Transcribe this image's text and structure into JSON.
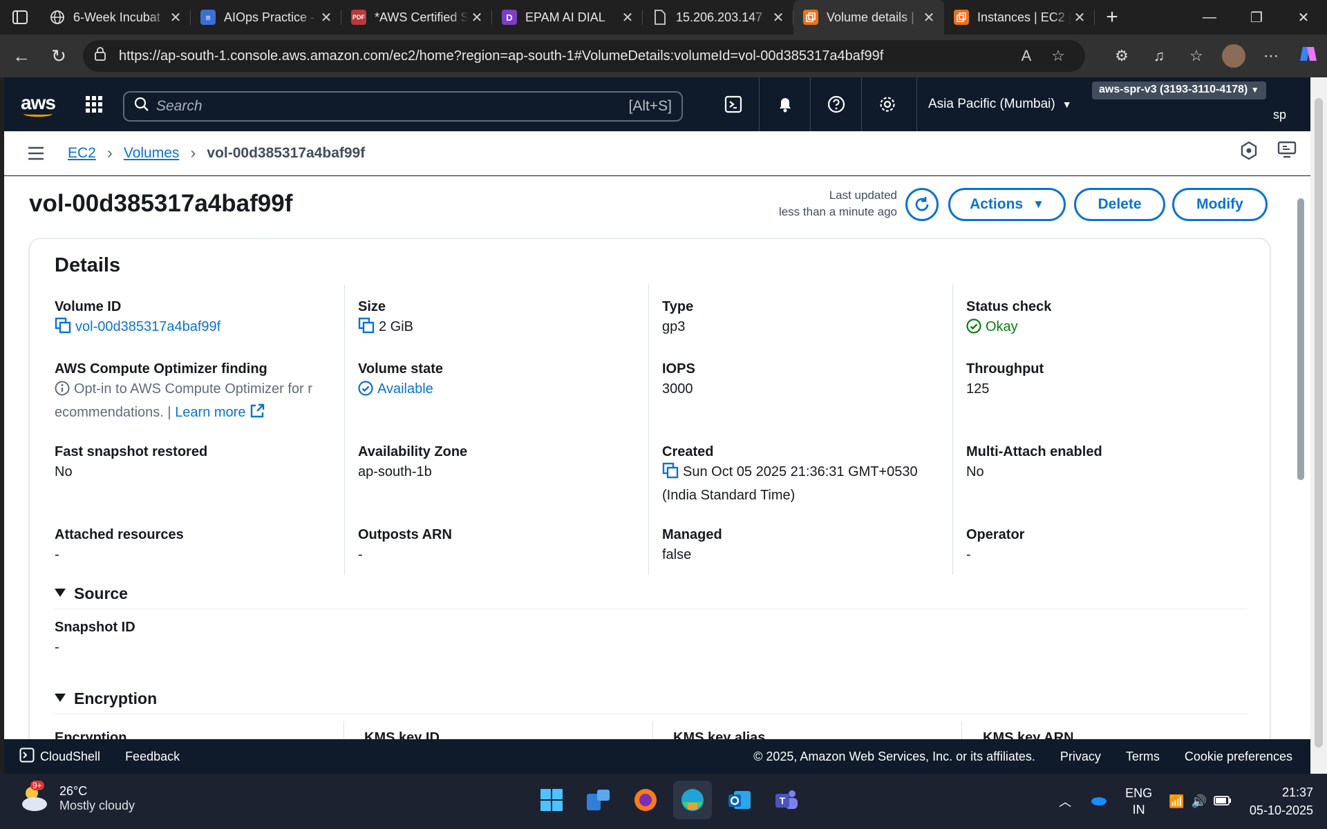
{
  "browser": {
    "tabs": [
      {
        "title": "6-Week Incubat",
        "icon": "globe-icon",
        "color": "#3a3a3a"
      },
      {
        "title": "AIOps Practice -",
        "icon": "docs-icon",
        "color": "#3b6fd6"
      },
      {
        "title": "*AWS Certified S",
        "icon": "pdf-icon",
        "color": "#b83a3a"
      },
      {
        "title": "EPAM AI DIAL",
        "icon": "dial-icon",
        "color": "#7b3fc4"
      },
      {
        "title": "15.206.203.147",
        "icon": "page-icon",
        "color": "#3a3a3a"
      },
      {
        "title": "Volume details |",
        "icon": "aws-ec2-icon",
        "color": "#e8731d",
        "active": true
      },
      {
        "title": "Instances | EC2 |",
        "icon": "aws-ec2-icon",
        "color": "#e8731d"
      }
    ],
    "url": "https://ap-south-1.console.aws.amazon.com/ec2/home?region=ap-south-1#VolumeDetails:volumeId=vol-00d385317a4baf99f"
  },
  "aws": {
    "search_placeholder": "Search",
    "search_shortcut": "[Alt+S]",
    "region": "Asia Pacific (Mumbai)",
    "account": "aws-spr-v3 (3193-3110-4178)",
    "user": "sp"
  },
  "breadcrumb": {
    "items": [
      "EC2",
      "Volumes",
      "vol-00d385317a4baf99f"
    ]
  },
  "page": {
    "title": "vol-00d385317a4baf99f",
    "last_updated_label": "Last updated",
    "last_updated_value": "less than a minute ago",
    "actions_label": "Actions",
    "delete_label": "Delete",
    "modify_label": "Modify"
  },
  "details": {
    "heading": "Details",
    "volume_id": {
      "label": "Volume ID",
      "value": "vol-00d385317a4baf99f"
    },
    "size": {
      "label": "Size",
      "value": "2 GiB"
    },
    "type": {
      "label": "Type",
      "value": "gp3"
    },
    "status_check": {
      "label": "Status check",
      "value": "Okay"
    },
    "optimizer": {
      "label": "AWS Compute Optimizer finding",
      "value_line1": "Opt-in to AWS Compute Optimizer for r",
      "value_line2": "ecommendations. |",
      "learn_more": "Learn more"
    },
    "volume_state": {
      "label": "Volume state",
      "value": "Available"
    },
    "iops": {
      "label": "IOPS",
      "value": "3000"
    },
    "throughput": {
      "label": "Throughput",
      "value": "125"
    },
    "fast_snapshot": {
      "label": "Fast snapshot restored",
      "value": "No"
    },
    "az": {
      "label": "Availability Zone",
      "value": "ap-south-1b"
    },
    "created": {
      "label": "Created",
      "value_line1": "Sun Oct 05 2025 21:36:31 GMT+0530",
      "value_line2": "(India Standard Time)"
    },
    "multi_attach": {
      "label": "Multi-Attach enabled",
      "value": "No"
    },
    "attached": {
      "label": "Attached resources",
      "value": "-"
    },
    "outposts": {
      "label": "Outposts ARN",
      "value": "-"
    },
    "managed": {
      "label": "Managed",
      "value": "false"
    },
    "operator": {
      "label": "Operator",
      "value": "-"
    }
  },
  "source": {
    "heading": "Source",
    "snapshot_label": "Snapshot ID",
    "snapshot_value": "-"
  },
  "encryption": {
    "heading": "Encryption",
    "cols": [
      "Encryption",
      "KMS key ID",
      "KMS key alias",
      "KMS key ARN"
    ]
  },
  "footer": {
    "cloudshell": "CloudShell",
    "feedback": "Feedback",
    "copyright": "© 2025, Amazon Web Services, Inc. or its affiliates.",
    "privacy": "Privacy",
    "terms": "Terms",
    "cookies": "Cookie preferences"
  },
  "taskbar": {
    "temp": "26°C",
    "weather": "Mostly cloudy",
    "badge": "9+",
    "lang1": "ENG",
    "lang2": "IN",
    "time": "21:37",
    "date": "05-10-2025"
  },
  "colors": {
    "aws_nav": "#0f1b2a",
    "link": "#0972d3",
    "ok": "#037f0c",
    "aws_orange": "#ff9900"
  }
}
